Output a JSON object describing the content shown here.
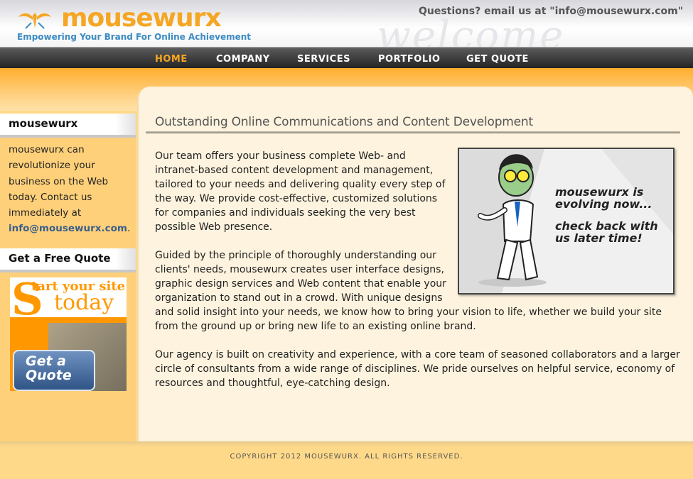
{
  "header": {
    "logo_text": "mousewurx",
    "tagline": "Empowering Your Brand For Online Achievement",
    "contact": "Questions?   email us at \"info@mousewurx.com\"",
    "watermark": "welcome"
  },
  "nav": {
    "items": [
      {
        "label": "HOME",
        "active": true
      },
      {
        "label": "COMPANY"
      },
      {
        "label": "SERVICES"
      },
      {
        "label": "PORTFOLIO"
      },
      {
        "label": "GET QUOTE"
      }
    ]
  },
  "sidebar": {
    "heading1": "mousewurx",
    "intro": "mousewurx can revolutionize your business on the Web today. Contact us immediately at ",
    "email": "info@mousewurx.com",
    "email_suffix": ".",
    "heading2": "Get a Free Quote",
    "promo": {
      "letter": "S",
      "line1": "tart your site",
      "line2": "today",
      "button": "Get a Quote"
    }
  },
  "content": {
    "title": "Outstanding Online Communications and Content Development",
    "hero_line1": "mousewurx is evolving now...",
    "hero_line2": "check back with us later time!",
    "p1": "Our team offers your business complete Web- and intranet-based content development and management, tailored to your needs and delivering quality every step of the way. We provide cost-effective, customized solutions for companies and individuals seeking the very best possible Web presence.",
    "p2a": "Guided by the principle of thoroughly understanding our clients' needs, mousewurx creates user interface designs, graphic design services and Web content that enable your organization to stand out in a crowd. With unique designs",
    "p2b": "and solid insight into your needs, we know how to bring your vision to life, whether we build your site from the ground up or bring new life to an existing online brand.",
    "p3": "Our agency is built on creativity and experience, with a core team of seasoned collaborators and a larger circle of consultants from a wide range of disciplines. We pride ourselves on helpful service, economy of resources and thoughtful, eye-catching design."
  },
  "footer": {
    "copyright": "COPYRIGHT 2012 MOUSEWURX. ALL RIGHTS RESERVED."
  },
  "colors": {
    "brand_orange": "#f5a623",
    "nav_dark": "#2a2a2a",
    "link_blue": "#3a5f8c"
  }
}
